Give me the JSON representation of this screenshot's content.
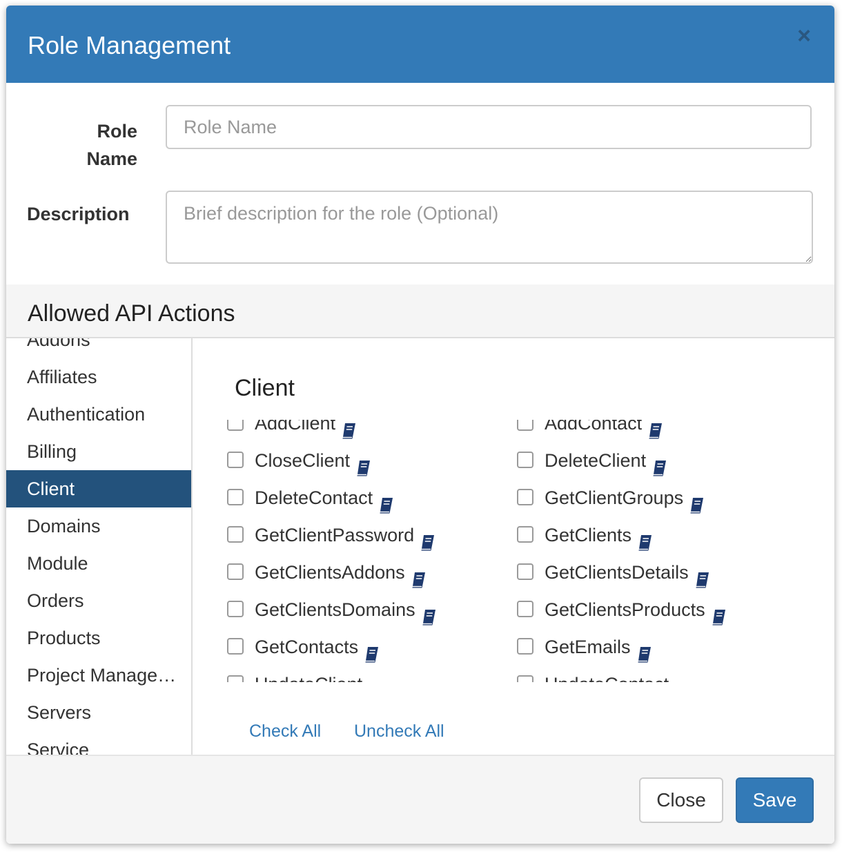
{
  "header": {
    "title": "Role Management",
    "close_glyph": "×"
  },
  "form": {
    "role_name_label": "Role Name",
    "role_name_placeholder": "Role Name",
    "role_name_value": "",
    "description_label": "Description",
    "description_placeholder": "Brief description for the role (Optional)",
    "description_value": ""
  },
  "section": {
    "title": "Allowed API Actions"
  },
  "sidebar": {
    "items": [
      {
        "label": "Addons",
        "active": false
      },
      {
        "label": "Affiliates",
        "active": false
      },
      {
        "label": "Authentication",
        "active": false
      },
      {
        "label": "Billing",
        "active": false
      },
      {
        "label": "Client",
        "active": true
      },
      {
        "label": "Domains",
        "active": false
      },
      {
        "label": "Module",
        "active": false
      },
      {
        "label": "Orders",
        "active": false
      },
      {
        "label": "Products",
        "active": false
      },
      {
        "label": "Project Management",
        "active": false
      },
      {
        "label": "Servers",
        "active": false
      },
      {
        "label": "Service",
        "active": false
      }
    ]
  },
  "content": {
    "title": "Client",
    "actions": [
      {
        "label": "AddClient",
        "checked": false
      },
      {
        "label": "AddContact",
        "checked": false
      },
      {
        "label": "CloseClient",
        "checked": false
      },
      {
        "label": "DeleteClient",
        "checked": false
      },
      {
        "label": "DeleteContact",
        "checked": false
      },
      {
        "label": "GetClientGroups",
        "checked": false
      },
      {
        "label": "GetClientPassword",
        "checked": false
      },
      {
        "label": "GetClients",
        "checked": false
      },
      {
        "label": "GetClientsAddons",
        "checked": false
      },
      {
        "label": "GetClientsDetails",
        "checked": false
      },
      {
        "label": "GetClientsDomains",
        "checked": false
      },
      {
        "label": "GetClientsProducts",
        "checked": false
      },
      {
        "label": "GetContacts",
        "checked": false
      },
      {
        "label": "GetEmails",
        "checked": false
      },
      {
        "label": "UpdateClient",
        "checked": false
      },
      {
        "label": "UpdateContact",
        "checked": false
      }
    ],
    "check_all_label": "Check All",
    "uncheck_all_label": "Uncheck All"
  },
  "footer": {
    "close_label": "Close",
    "save_label": "Save"
  },
  "colors": {
    "primary": "#337ab7",
    "active_nav": "#23527c",
    "doc_icon": "#1f3a6e",
    "panel_bg": "#f5f5f5"
  },
  "icons": {
    "action_doc": "book-icon",
    "dismiss": "close-icon"
  }
}
